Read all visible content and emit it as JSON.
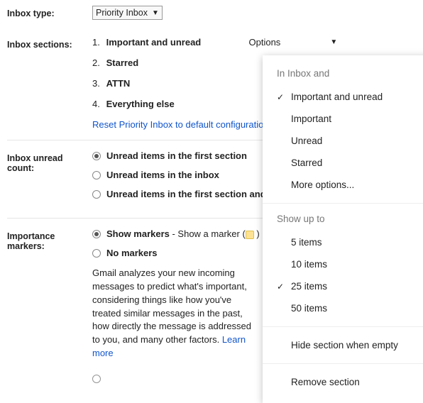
{
  "inbox_type": {
    "label": "Inbox type:",
    "select_value": "Priority Inbox"
  },
  "sections": {
    "label": "Inbox sections:",
    "items": [
      {
        "num": "1.",
        "name": "Important and unread"
      },
      {
        "num": "2.",
        "name": "Starred"
      },
      {
        "num": "3.",
        "name": "ATTN"
      },
      {
        "num": "4.",
        "name": "Everything else"
      }
    ],
    "options_label": "Options",
    "reset_link": "Reset Priority Inbox to default configuration"
  },
  "unread_count": {
    "label": "Inbox unread count:",
    "options": [
      {
        "text": "Unread items in the first section",
        "checked": true
      },
      {
        "text": "Unread items in the inbox",
        "checked": false
      },
      {
        "text": "Unread items in the first section and inbox",
        "checked": false
      }
    ]
  },
  "markers": {
    "label": "Importance markers:",
    "opt_show": "Show markers",
    "opt_show_tail": " - Show a marker (",
    "opt_show_tail2": " )",
    "opt_no": "No markers",
    "desc": "Gmail analyzes your new incoming messages to predict what's important, considering things like how you've treated similar messages in the past, how directly the message is addressed to you, and many other factors. ",
    "learn_more": "Learn more"
  },
  "dropdown": {
    "inbox_and": "In Inbox and",
    "filters": [
      {
        "text": "Important and unread",
        "checked": true
      },
      {
        "text": "Important",
        "checked": false
      },
      {
        "text": "Unread",
        "checked": false
      },
      {
        "text": "Starred",
        "checked": false
      },
      {
        "text": "More options...",
        "checked": false
      }
    ],
    "show_up_to": "Show up to",
    "counts": [
      {
        "text": "5 items",
        "checked": false
      },
      {
        "text": "10 items",
        "checked": false
      },
      {
        "text": "25 items",
        "checked": true
      },
      {
        "text": "50 items",
        "checked": false
      }
    ],
    "hide": "Hide section when empty",
    "remove": "Remove section"
  }
}
